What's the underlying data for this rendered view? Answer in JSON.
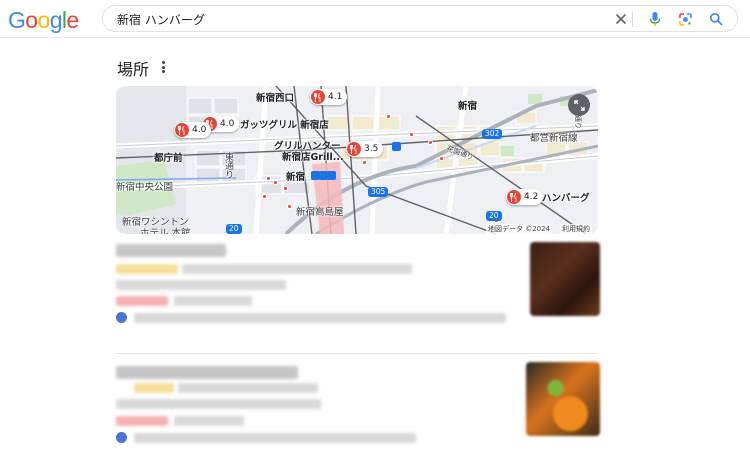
{
  "header": {
    "logo_letters": [
      {
        "ch": "G",
        "color": "#4285F4"
      },
      {
        "ch": "o",
        "color": "#EA4335"
      },
      {
        "ch": "o",
        "color": "#FBBC05"
      },
      {
        "ch": "g",
        "color": "#4285F4"
      },
      {
        "ch": "l",
        "color": "#34A853"
      },
      {
        "ch": "e",
        "color": "#EA4335"
      }
    ],
    "search_query": "新宿 ハンバーグ",
    "icons": [
      "close-icon",
      "microphone-icon",
      "lens-icon",
      "search-icon"
    ]
  },
  "places": {
    "title": "場所",
    "menu_icon": "more-vert-icon"
  },
  "map": {
    "labels": {
      "shinjuku_nishiguchi": "新宿西口",
      "shinjuku_top": "新宿",
      "gattsu_grill": "ガッツグリル 新宿店",
      "grill_hunter_1": "グリルハンター",
      "grill_hunter_2": "新宿店Grill...",
      "tochomae": "都庁前",
      "higashi_dori": "東通り",
      "chuo_park": "新宿中央公園",
      "shinjuku_station": "新宿",
      "takashimaya": "新宿高島屋",
      "washington_1": "新宿ワシントン",
      "washington_2": "ホテル 本館",
      "hanbahg": "ハンバーグ",
      "hanazono": "花園通り",
      "meiji": "明治通り",
      "toei_shinjuku": "都営新宿線",
      "route_302": "302",
      "route_305": "305",
      "route_20_a": "20",
      "route_20_b": "20"
    },
    "pins": [
      {
        "id": "pin-nishiguchi",
        "rating": "4.1"
      },
      {
        "id": "pin-gattsu",
        "rating": "4.0"
      },
      {
        "id": "pin-tochomae",
        "rating": "4.0"
      },
      {
        "id": "pin-grill-hunter",
        "rating": "3.5"
      },
      {
        "id": "pin-hanbahg",
        "rating": "4.2"
      }
    ],
    "footer_data": "地図データ ©2024",
    "footer_terms": "利用規約",
    "expand_icon": "fullscreen-icon",
    "colors": {
      "road_major": "#aab3bd",
      "park": "#cfe8c6",
      "rail": "#5f6368",
      "water": "#c6dbf2"
    }
  }
}
